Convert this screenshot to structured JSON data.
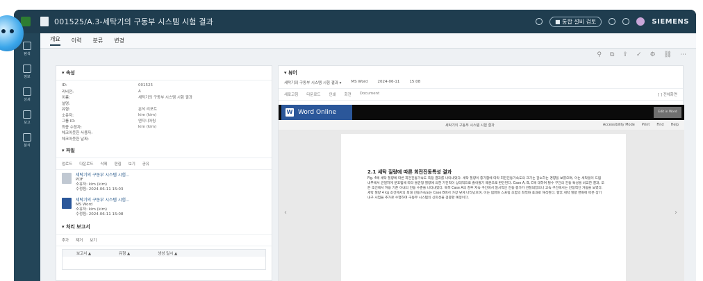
{
  "window": {
    "title": "001525/A.3-세탁기의 구동부 시스템 시험 결과",
    "brand": "SIEMENS",
    "pill": "■ 통합 설비 검토"
  },
  "rail": [
    "탐색",
    "정보",
    "상세",
    "보고",
    "분석"
  ],
  "tabs": [
    "개요",
    "이력",
    "분류",
    "변경"
  ],
  "properties": {
    "header": "▾ 속성",
    "rows": [
      {
        "k": "ID:",
        "v": "001525"
      },
      {
        "k": "리비전:",
        "v": "A"
      },
      {
        "k": "이름:",
        "v": "세탁기의 구동부 시스템 시험 결과"
      },
      {
        "k": "설명:",
        "v": ""
      },
      {
        "k": "유형:",
        "v": "분석 리포트"
      },
      {
        "k": "소유자:",
        "v": "kim (kim)"
      },
      {
        "k": "그룹 ID:",
        "v": "엔지니어링"
      },
      {
        "k": "최종 수정자:",
        "v": "kim (kim)"
      },
      {
        "k": "체크아웃한 사용자:",
        "v": ""
      },
      {
        "k": "체크아웃한 날짜:",
        "v": ""
      }
    ]
  },
  "files": {
    "header": "▾ 파일",
    "toolbar": [
      "업로드",
      "다운로드",
      "삭제",
      "편집",
      "보기",
      "공유"
    ],
    "items": [
      {
        "name": "세탁기의 구동부 시스템 시험...",
        "type": "PDF",
        "owner": "소유자: kim (kim)",
        "date": "수정됨: 2024-06-11 15:03"
      },
      {
        "name": "세탁기의 구동부 시스템 시험...",
        "type": "MS Word",
        "owner": "소유자: kim (kim)",
        "date": "수정됨: 2024-06-11 15:08"
      }
    ]
  },
  "report": {
    "header": "▾ 처리 보고서",
    "toolbar": [
      "추가",
      "제거",
      "보기"
    ],
    "cols": [
      "보고서 ▲",
      "유형 ▲",
      "생성 일시 ▲"
    ]
  },
  "viewer": {
    "header": "▾ 뷰어",
    "sub": [
      "세탁기의 구동부 시스템 시험 결과 ▾",
      "MS Word",
      "2024-06-11",
      "15:08"
    ],
    "tools": [
      "새로고침",
      "다운로드",
      "인쇄",
      "회전",
      "Document"
    ],
    "tools_right": "[ ] 전체화면",
    "app": "Word Online",
    "app_btn": "Edit in Word",
    "doc_title": "세탁기의 구동부 시스템 시험 결과",
    "doc_tools": [
      "Accessibility Mode",
      "Print",
      "Find",
      "Help"
    ],
    "heading": "2.1 세탁 질량에 따른 회전진동특성 결과",
    "para": "Fig. 4에 세탁 질량에 따른 회전진동가속도 측정 결과를 나타내었다. 세탁 질량이 증가함에 따라 회전진동가속도의 크기는 감소하는 경향을 보였으며, 이는 세탁물이 드럼 내부에서 균일하게 분포됨에 따라 불균형 질량에 의한 가진력이 상대적으로 줄어들기 때문으로 판단된다. Case A, B, C에 대하여 탈수 구간의 진동 특성을 비교한 결과, 모든 조건에서 허용 기준 이내의 진동 수준을 나타내었다. 특히 Case A의 경우 저속 구간에서 일시적인 진동 증가가 관찰되었으나 고속 구간에서는 안정적인 거동을 보였다. 세탁 질량 4 kg 조건에서의 최대 진동가속도는 Case B에서 가장 낮게 나타났으며, 이는 댐퍼와 스프링 조합의 최적화 효과로 해석된다. 향후 세탁 질량 변화에 따른 장기 내구 시험을 추가로 수행하여 구동부 시스템의 신뢰성을 검증할 예정이다."
  }
}
